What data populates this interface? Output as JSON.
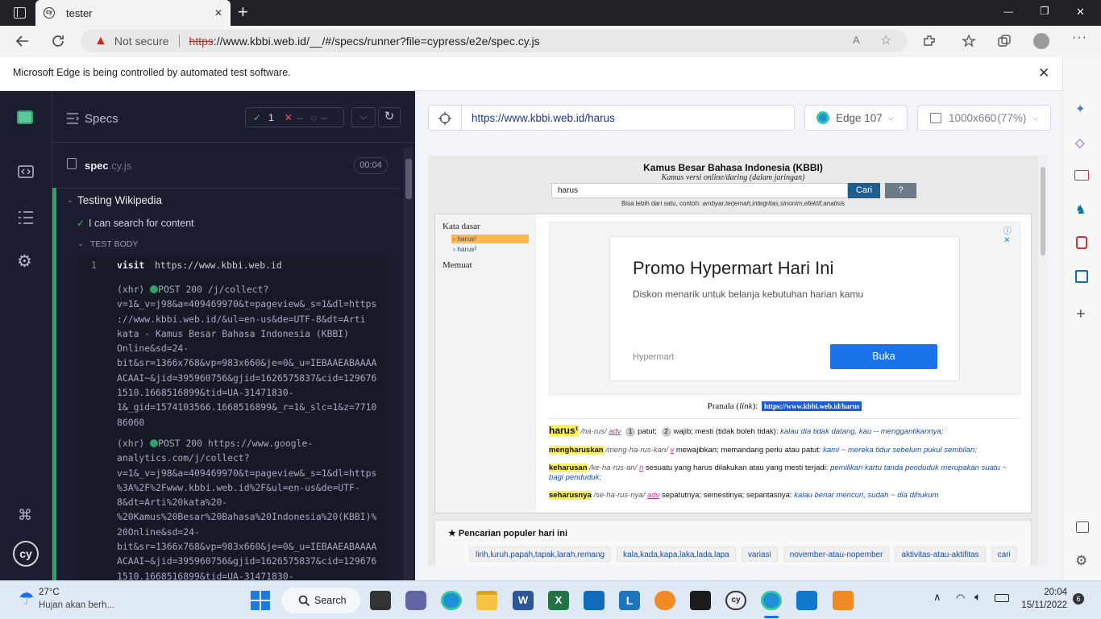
{
  "browser": {
    "tab_title": "tester",
    "tab_close": "✕",
    "new_tab": "+",
    "not_secure": "Not secure",
    "url_scheme": "https",
    "url_rest": "://www.kbbi.web.id/__/#/specs/runner?file=cypress/e2e/spec.cy.js",
    "window_min": "—",
    "window_max": "❐",
    "window_close": "✕",
    "info_text": "Microsoft Edge is being controlled by automated test software.",
    "info_close": "✕"
  },
  "cypress": {
    "specs_label": "Specs",
    "passed": "1",
    "failed": "--",
    "pending": "--",
    "spec_name": "spec",
    "spec_ext": ".cy.js",
    "spec_time": "00:04",
    "suite": "Testing Wikipedia",
    "test": "I can search for content",
    "test_body": "TEST BODY",
    "cmd_num": "1",
    "cmd_name": "visit",
    "cmd_url": "https://www.kbbi.web.id",
    "log1_prefix": "(xhr)",
    "log1_head": "POST 200 /j/collect?",
    "log1_lines": [
      "v=1&_v=j98&a=409469970&t=pageview&_s=1&dl=https",
      "://www.kbbi.web.id/&ul=en-us&de=UTF-8&dt=Arti",
      "kata - Kamus Besar Bahasa Indonesia (KBBI)",
      "Online&sd=24-",
      "bit&sr=1366x768&vp=983x660&je=0&_u=IEBAAEABAAAA",
      "ACAAI~&jid=395960756&gjid=1626575837&cid=129676",
      "1510.1668516899&tid=UA-31471830-",
      "1&_gid=1574103566.1668516899&_r=1&_slc=1&z=7710",
      "86060"
    ],
    "log2_prefix": "(xhr)",
    "log2_head": "POST 200 https://www.google-",
    "log2_lines": [
      "analytics.com/j/collect?",
      "v=1&_v=j98&a=409469970&t=pageview&_s=1&dl=https",
      "%3A%2F%2Fwww.kbbi.web.id%2F&ul=en-us&de=UTF-",
      "8&dt=Arti%20kata%20-",
      "%20Kamus%20Besar%20Bahasa%20Indonesia%20(KBBI)%",
      "20Online&sd=24-",
      "bit&sr=1366x768&vp=983x660&je=0&_u=IEBAAEABAAAA",
      "ACAAI~&jid=395960756&gjid=1626575837&cid=129676",
      "1510.1668516899&tid=UA-31471830-"
    ]
  },
  "aut": {
    "url": "https://www.kbbi.web.id/harus",
    "browser": "Edge 107",
    "viewport": "1000x660",
    "scale": "(77%)"
  },
  "kbbi": {
    "title": "Kamus Besar Bahasa Indonesia (KBBI)",
    "subtitle": "Kamus versi online/daring (dalam jaringan)",
    "search_value": "harus",
    "cari": "Cari",
    "help": "?",
    "hint_prefix": "Bisa lebih dari satu, contoh:",
    "hint_example": "ambyar,terjemah,integritas,sinonim,efektif,analisis",
    "side_head": "Kata dasar",
    "side_items": [
      "harus¹",
      "harus²"
    ],
    "side_memuat": "Memuat",
    "ad_title": "Promo Hypermart Hari Ini",
    "ad_desc": "Diskon menarik untuk belanja kebutuhan harian kamu",
    "ad_brand": "Hypermart",
    "ad_button": "Buka",
    "pranala_label": "Pranala (",
    "pranala_link": "link",
    "pranala_end": "):",
    "pranala_url": "https://www.kbbi.web.id/harus",
    "entries": [
      {
        "word": "harus¹",
        "pron": "/ha·rus/",
        "cls": "adv",
        "def": "patut; wajib; mesti (tidak boleh tidak):",
        "n1": "1",
        "n2": "2",
        "def1": "patut;",
        "def2": "wajib; mesti (tidak boleh tidak):",
        "ex": "kalau dia tidak datang, kau -- menggantikannya;"
      },
      {
        "word": "mengharuskan",
        "pron": "/meng·ha·rus·kan/",
        "cls": "v",
        "def": "mewajibkan; memandang perlu atau patut:",
        "ex": "kami ~ mereka tidur sebelum pukul sembilan;"
      },
      {
        "word": "keharusan",
        "pron": "/ke·ha·rus·an/",
        "cls": "n",
        "def": "sesuatu yang harus dilakukan atau yang mesti terjadi:",
        "ex": "pemilikan kartu tanda penduduk merupakan",
        "ex2": "suatu ~ bagi penduduk;"
      },
      {
        "word": "seharusnya",
        "pron": "/se·ha·rus·nya/",
        "cls": "adv",
        "def": "sepatutnya; semestinya; sepantasnya:",
        "ex": "kalau benar mencuri, sudah ~ dia dihukum"
      }
    ],
    "popular_title": "★ Pencarian populer hari ini",
    "popular_tags": [
      "lirih,luruh,papah,tapak,larah,remang",
      "kala,kada,kapa,laka,lada,lapa",
      "variasi",
      "november-atau-nopember",
      "aktivitas-atau-aktifitas",
      "cari"
    ]
  },
  "taskbar": {
    "temp": "27°C",
    "weather": "Hujan akan berh...",
    "search": "Search",
    "time": "20:04",
    "date": "15/11/2022",
    "notif": "6"
  }
}
